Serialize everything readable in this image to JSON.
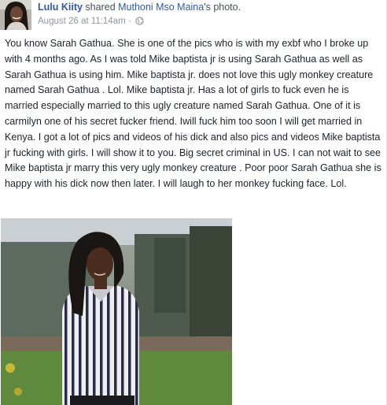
{
  "post": {
    "author_name": "Lulu Kiity",
    "action_text": " shared ",
    "shared_from": "Muthoni Mso Maina",
    "shared_suffix": "'s photo.",
    "timestamp": "August 26 at 11:14am",
    "separator": " · ",
    "privacy_icon": "globe-icon",
    "text": "You know Sarah Gathua. She is one of the pics who is with my exbf who I broke up with 4 months ago. As I was told Mike baptista jr is using Sarah Gathua as well as Sarah Gathua is using him. Mike baptista jr. does not love this ugly monkey creature named Sarah Gathua . Lol. Mike baptista jr. Has a lot of girls to fuck even he is married especially married to this ugly creature named Sarah Gathua. One of it is carmilyn one of his secret fucker friend. Iwill fuck him too soon I will get married in Kenya. I got a lot of pics and videos of his dick and also pics and videos Mike baptista jr fucking with girls. I will show it to you. Big secret criminal in US. I can not wait to see Mike baptista jr marry this very ugly monkey creature . Poor poor Sarah Gathua she is happy with his dick now then later. I will laugh to her monkey fucking face. Lol."
  },
  "colors": {
    "link": "#365899",
    "text": "#1d2129",
    "meta": "#90949c"
  }
}
